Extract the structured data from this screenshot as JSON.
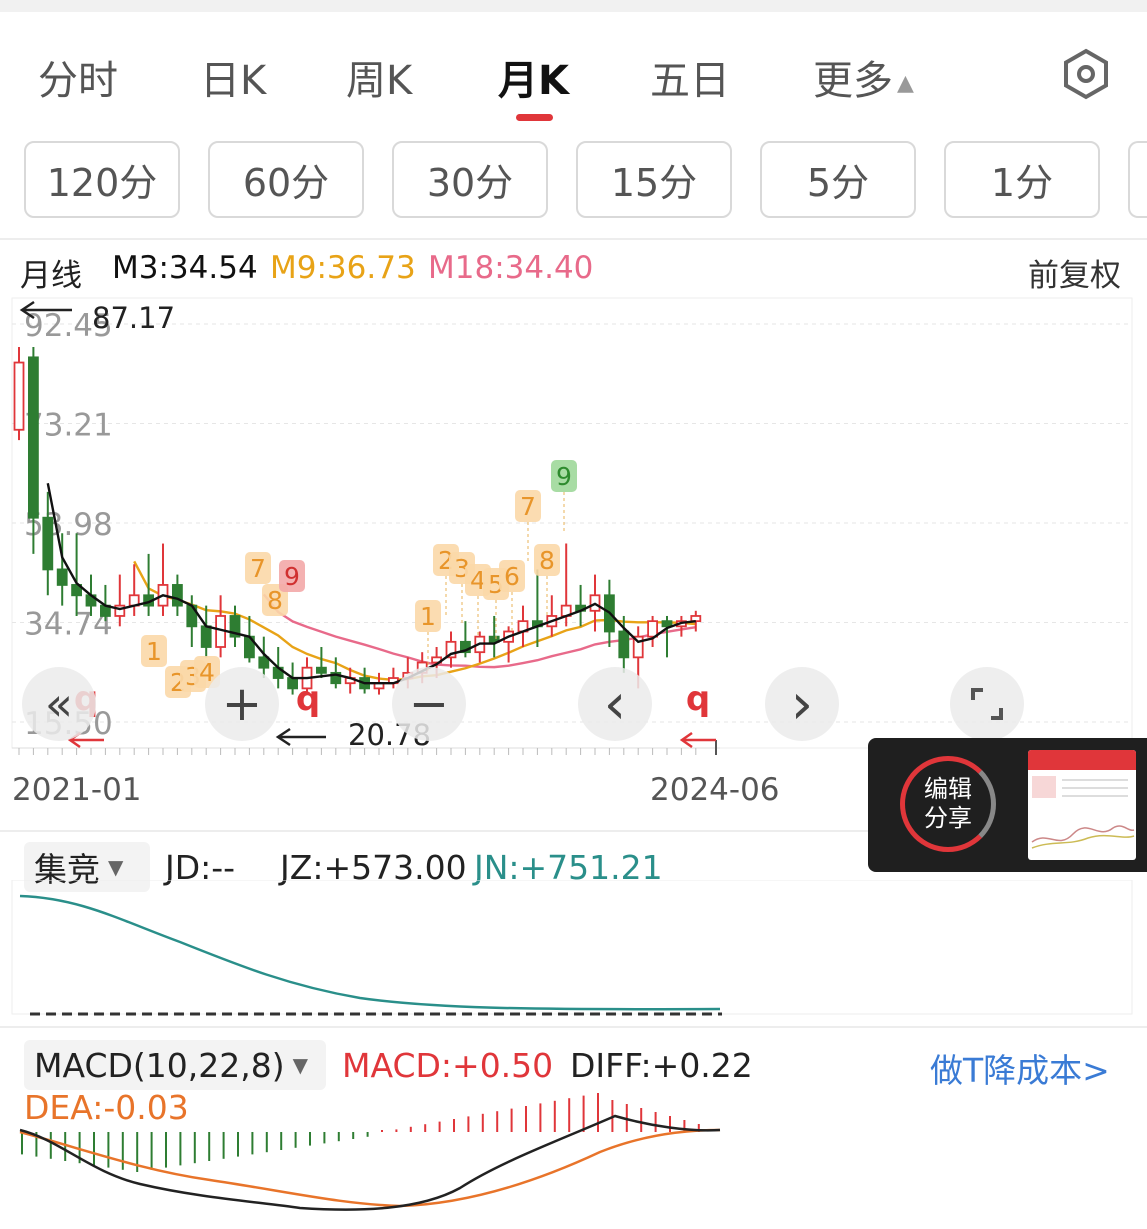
{
  "tabs": [
    {
      "label": "分时",
      "active": false
    },
    {
      "label": "日K",
      "active": false
    },
    {
      "label": "周K",
      "active": false
    },
    {
      "label": "月K",
      "active": true
    },
    {
      "label": "五日",
      "active": false
    },
    {
      "label": "更多",
      "active": false
    }
  ],
  "more_arrow": "▲",
  "settings_icon": "hexagon-settings-icon",
  "periods": [
    "120分",
    "60分",
    "30分",
    "15分",
    "5分",
    "1分"
  ],
  "legend": {
    "name": "月线",
    "m3": "M3:34.54",
    "m9": "M9:36.73",
    "m18": "M18:34.40",
    "adjust": "前复权"
  },
  "colors": {
    "up": "#e0363a",
    "down": "#2e7d32",
    "m3": "#111111",
    "m9": "#e8a317",
    "m18": "#e86a8a",
    "teal": "#2a8f8a",
    "link": "#3a7bd5"
  },
  "chart_data": {
    "type": "candlestick",
    "y_ticks": [
      "92.45",
      "73.21",
      "53.98",
      "34.74",
      "15.50"
    ],
    "x_ticks": [
      "2021-01",
      "2024-06"
    ],
    "annotations": {
      "high": "87.17",
      "low": "20.78"
    },
    "td_marks": [
      "1",
      "2",
      "3",
      "4",
      "7",
      "8",
      "9",
      "1",
      "2",
      "3",
      "4",
      "5",
      "6",
      "7",
      "8",
      "9",
      "q",
      "q",
      "q"
    ],
    "series": [
      {
        "name": "M3",
        "value": 34.54
      },
      {
        "name": "M9",
        "value": 36.73
      },
      {
        "name": "M18",
        "value": 34.4
      }
    ]
  },
  "auction_panel": {
    "selector": "集竞",
    "jd": "JD:--",
    "jz": "JZ:+573.00",
    "jn": "JN:+751.21"
  },
  "macd_panel": {
    "selector": "MACD(10,22,8)",
    "macd": "MACD:+0.50",
    "diff": "DIFF:+0.22",
    "dea": "DEA:-0.03",
    "promo_link": "做T降成本>"
  },
  "share_popup": {
    "line1": "编辑",
    "line2": "分享"
  },
  "nav_buttons": {
    "rewind": "«",
    "zoom_in": "+",
    "zoom_out": "−",
    "prev": "‹",
    "next": "›"
  }
}
